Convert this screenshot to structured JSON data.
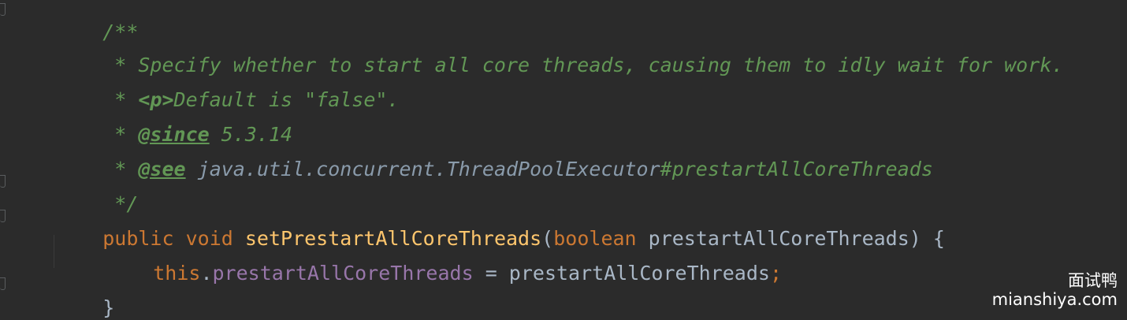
{
  "code": {
    "line1": {
      "comment": "/**"
    },
    "line2": {
      "comment": " * Specify whether to start all core threads, causing them to idly wait for work."
    },
    "line3": {
      "prefix": " * ",
      "tag": "<p>",
      "text": "Default is \"false\"."
    },
    "line4": {
      "prefix": " * ",
      "tag": "@since",
      "text": " 5.3.14"
    },
    "line5": {
      "prefix": " * ",
      "tag": "@see",
      "space": " ",
      "ref": "java.util.concurrent.ThreadPoolExecutor",
      "member": "#prestartAllCoreThreads"
    },
    "line6": {
      "comment": " */"
    },
    "line7": {
      "kw_public": "public",
      "kw_void": "void",
      "method": "setPrestartAllCoreThreads",
      "open_paren": "(",
      "kw_boolean": "boolean",
      "param": "prestartAllCoreThreads",
      "close": ") {"
    },
    "line8": {
      "kw_this": "this",
      "dot": ".",
      "field": "prestartAllCoreThreads",
      "assign": " = ",
      "value": "prestartAllCoreThreads",
      "semicolon": ";"
    },
    "line9": {
      "brace": "}"
    }
  },
  "watermark": {
    "title": "面试鸭",
    "url": "mianshiya.com"
  }
}
